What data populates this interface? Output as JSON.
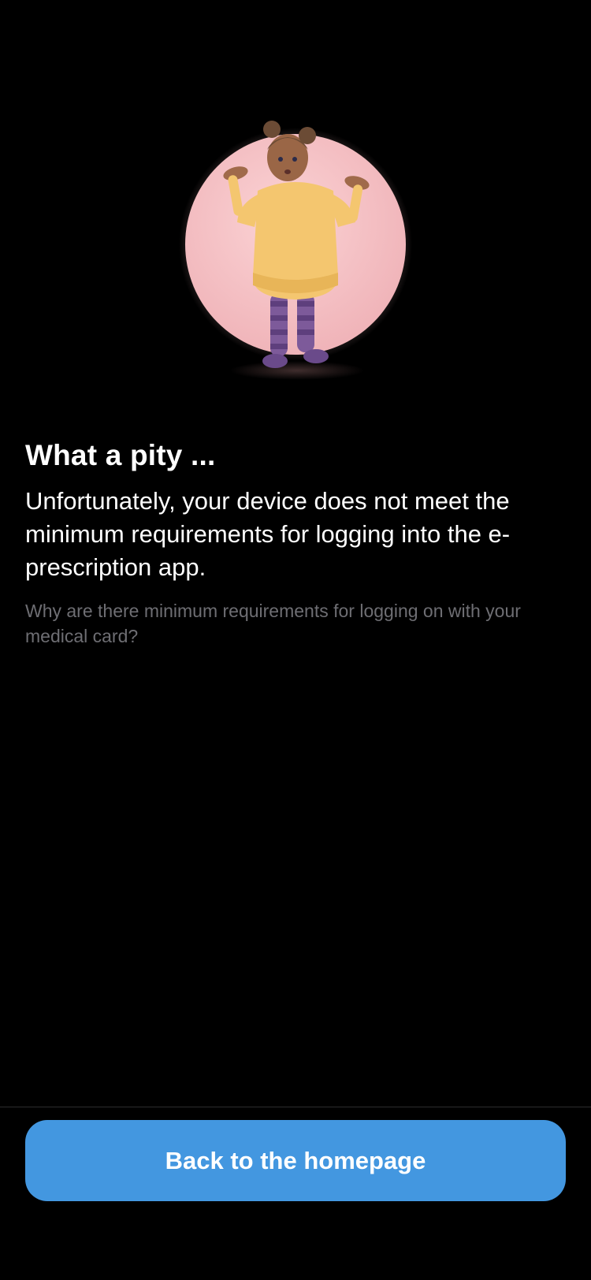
{
  "screen": {
    "illustration_icon": "shrugging-girl-illustration",
    "title": "What a pity ...",
    "message": "Unfortunately, your device does not meet the minimum requirements for logging into the e-prescription app.",
    "info_link": "Why are there minimum requirements for logging on with your medical card?"
  },
  "footer": {
    "button_label": "Back to the homepage"
  },
  "colors": {
    "background": "#000000",
    "accent": "#4397e0",
    "secondary_text": "#6e6e73",
    "illustration_circle": "#f7c5c8"
  }
}
